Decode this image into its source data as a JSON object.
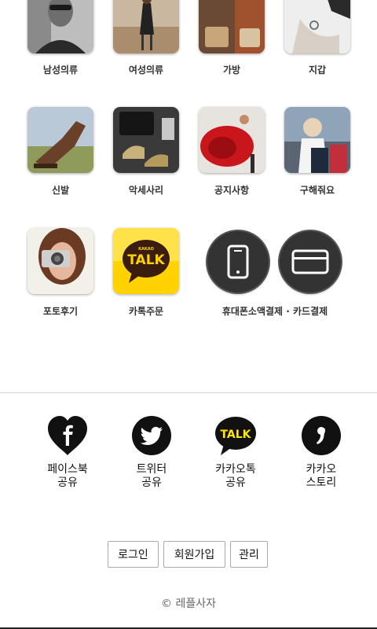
{
  "menu": {
    "items": [
      {
        "label": "남성의류"
      },
      {
        "label": "여성의류"
      },
      {
        "label": "가방"
      },
      {
        "label": "지갑"
      },
      {
        "label": "신발"
      },
      {
        "label": "악세사리"
      },
      {
        "label": "공지사항"
      },
      {
        "label": "구해줘요"
      },
      {
        "label": "포토후기"
      },
      {
        "label": "카톡주문"
      }
    ],
    "payment_label": "휴대폰소액결제 · 카드결제",
    "kakao_tile": {
      "small": "KAKAO",
      "big": "TALK"
    }
  },
  "share": {
    "items": [
      {
        "line1": "페이스북",
        "line2": "공유",
        "icon": "facebook-heart-icon"
      },
      {
        "line1": "트위터",
        "line2": "공유",
        "icon": "twitter-icon"
      },
      {
        "line1": "카카오톡",
        "line2": "공유",
        "icon": "kakaotalk-icon"
      },
      {
        "line1": "카카오",
        "line2": "스토리",
        "icon": "kakaostory-icon"
      }
    ],
    "talk_text": "TALK"
  },
  "account": {
    "login": "로그인",
    "signup": "회원가입",
    "admin": "관리"
  },
  "footer": {
    "copyright": "© 레플사자"
  },
  "colors": {
    "kakao_yellow": "#fee500",
    "dark": "#222222"
  }
}
